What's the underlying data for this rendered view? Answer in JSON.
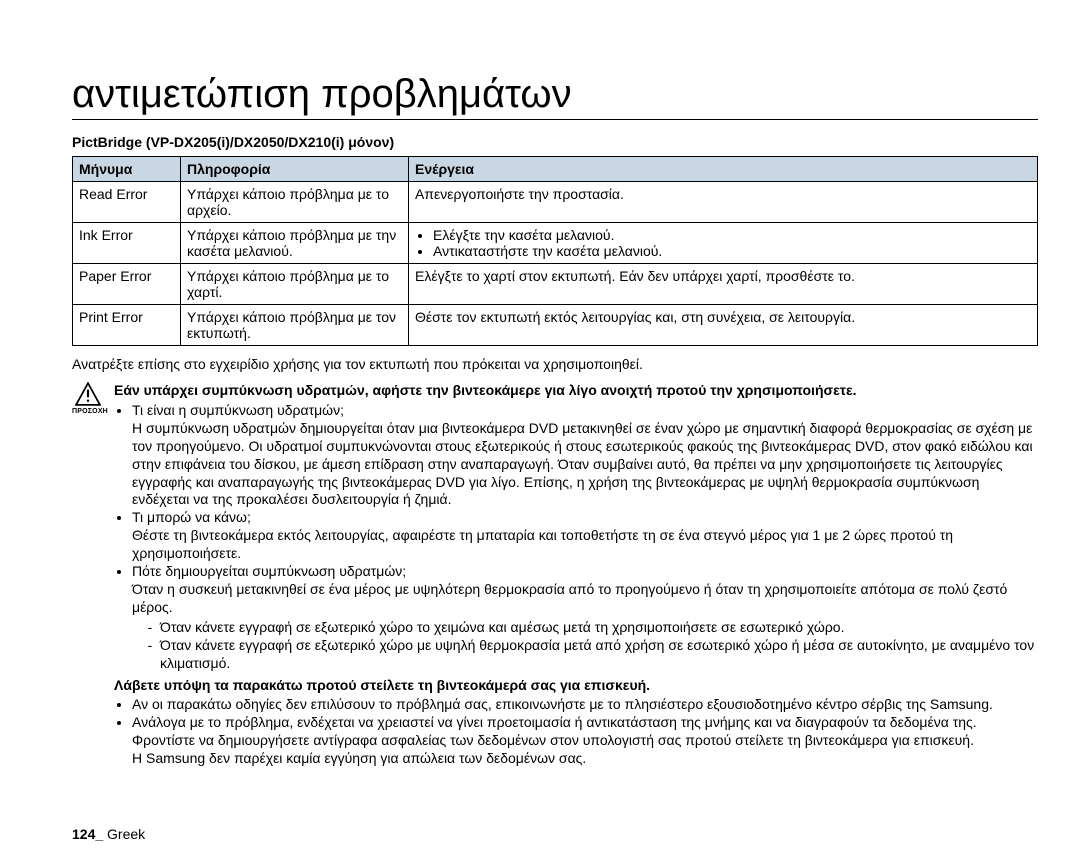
{
  "title": "αντιμετώπιση προβλημάτων",
  "subheading": "PictBridge (VP-DX205(i)/DX2050/DX210(i) μόνον)",
  "table": {
    "headers": [
      "Μήνυμα",
      "Πληροφορία",
      "Ενέργεια"
    ],
    "rows": [
      {
        "msg": "Read Error",
        "info": "Υπάρχει κάποιο πρόβλημα με το αρχείο.",
        "act": "Απενεργοποιήστε την προστασία."
      },
      {
        "msg": "Ink Error",
        "info": "Υπάρχει κάποιο πρόβλημα με την κασέτα μελανιού.",
        "act_list": [
          "Ελέγξτε την κασέτα μελανιού.",
          "Αντικαταστήστε την κασέτα μελανιού."
        ]
      },
      {
        "msg": "Paper Error",
        "info": "Υπάρχει κάποιο πρόβλημα με το χαρτί.",
        "act": "Ελέγξτε το χαρτί στον εκτυπωτή. Εάν δεν υπάρχει χαρτί, προσθέστε το."
      },
      {
        "msg": "Print Error",
        "info": "Υπάρχει κάποιο πρόβλημα με τον εκτυπωτή.",
        "act": "Θέστε τον εκτυπωτή εκτός λειτουργίας και, στη συνέχεια, σε λειτουργία."
      }
    ]
  },
  "after_table": "Ανατρέξτε επίσης στο εγχειρίδιο χρήσης για τον εκτυπωτή που πρόκειται να χρησιμοποιηθεί.",
  "caution_label": "ΠΡΟΣΟΧΗ",
  "caution": {
    "lead_bold": "Εάν υπάρχει συμπύκνωση υδρατμών, αφήστε την βιντεοκάμερε για λίγο ανοιχτή προτού την χρησιμοποιήσετε.",
    "items": [
      {
        "q": "Τι είναι η συμπύκνωση υδρατμών;",
        "a": "Η συμπύκνωση υδρατμών δημιουργείται όταν μια βιντεοκάμερα DVD μετακινηθεί σε έναν χώρο με σημαντική διαφορά θερμοκρασίας σε σχέση με τον προηγούμενο. Οι υδρατμοί συμπυκνώνονται στους εξωτερικούς ή στους εσωτερικούς φακούς της βιντεοκάμερας DVD, στον φακό ειδώλου και στην επιφάνεια του δίσκου, με άμεση επίδραση στην αναπαραγωγή. Όταν συμβαίνει αυτό, θα πρέπει να μην χρησιμοποιήσετε τις λειτουργίες εγγραφής και αναπαραγωγής της βιντεοκάμερας DVD για λίγο. Επίσης, η χρήση της βιντεοκάμερας με υψηλή θερμοκρασία συμπύκνωση ενδέχεται να της προκαλέσει δυσλειτουργία ή ζημιά."
      },
      {
        "q": "Τι μπορώ να κάνω;",
        "a": "Θέστε τη βιντεοκάμερα εκτός λειτουργίας, αφαιρέστε τη μπαταρία και τοποθετήστε τη σε ένα στεγνό μέρος για 1 με 2 ώρες προτού τη χρησιμοποιήσετε."
      },
      {
        "q": "Πότε δημιουργείται συμπύκνωση υδρατμών;",
        "a": "Όταν η συσκευή μετακινηθεί σε ένα μέρος με υψηλότερη θερμοκρασία από το προηγούμενο ή όταν τη χρησιμοποιείτε απότομα σε πολύ ζεστό μέρος.",
        "sub": [
          "Όταν κάνετε εγγραφή σε εξωτερικό χώρο το χειμώνα και αμέσως μετά τη χρησιμοποιήσετε σε εσωτερικό χώρο.",
          "Όταν κάνετε εγγραφή σε εξωτερικό χώρο με υψηλή θερμοκρασία μετά από χρήση σε εσωτερικό χώρο ή μέσα σε αυτοκίνητο, με αναμμένο τον κλιματισμό."
        ]
      }
    ],
    "lead2_bold": "Λάβετε υπόψη τα παρακάτω προτού στείλετε τη βιντεοκάμερά σας για επισκευή.",
    "items2": [
      "Αν οι παρακάτω οδηγίες δεν επιλύσουν το πρόβλημά σας, επικοινωνήστε με το πλησιέστερο εξουσιοδοτημένο κέντρο σέρβις της Samsung.",
      "Ανάλογα με το πρόβλημα, ενδέχεται να χρειαστεί να γίνει προετοιμασία ή αντικατάσταση της μνήμης και να διαγραφούν τα δεδομένα της.\nΦροντίστε να δημιουργήσετε αντίγραφα ασφαλείας των δεδομένων στον υπολογιστή σας προτού στείλετε τη βιντεοκάμερα για επισκευή.\nΗ Samsung δεν παρέχει καμία εγγύηση για απώλεια των δεδομένων σας."
    ]
  },
  "page_number": "124_",
  "page_lang": "Greek"
}
